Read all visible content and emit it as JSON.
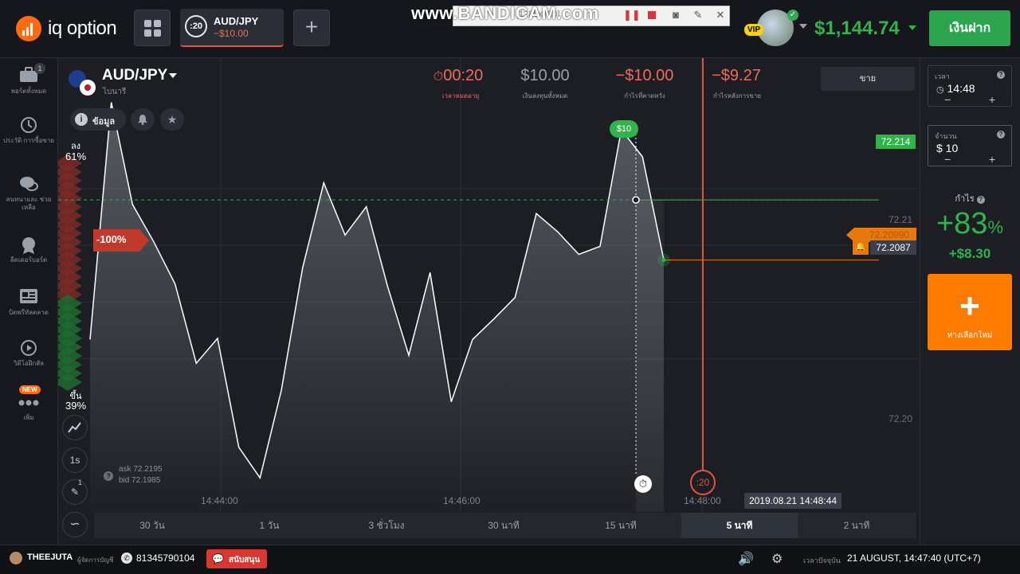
{
  "header": {
    "logo_text": "iq option",
    "asset_tab": {
      "timer": ":20",
      "name": "AUD/JPY",
      "loss": "−$10.00"
    },
    "add_tab_label": "+",
    "recorder": {
      "brand": "www.BANDICAM.com",
      "info": "[1280x720]"
    },
    "vip_label": "VIP",
    "balance": "$1,144.74",
    "deposit_label": "เงินฝาก"
  },
  "sidebar": {
    "items": [
      {
        "label": "พอร์ตทั้งหมด",
        "icon": "briefcase-icon",
        "badge": "1"
      },
      {
        "label": "ประวัติ การซื้อขาย",
        "icon": "history-icon"
      },
      {
        "label": "สนทนาและ ช่วยเหลือ",
        "icon": "chat-icon"
      },
      {
        "label": "ลีดเดอร์บอร์ด",
        "icon": "leaderboard-icon"
      },
      {
        "label": "บิดพรีทัลตลาด",
        "icon": "news-icon"
      },
      {
        "label": "วิดีโอฝึกสัล",
        "icon": "video-icon"
      },
      {
        "label": "เพิ่ม",
        "icon": "more-icon",
        "badge": "NEW"
      }
    ]
  },
  "asset": {
    "pair": "AUD/JPY",
    "type": "ไบนารี",
    "info_label": "ข้อมูล"
  },
  "stats": {
    "timer": {
      "value": "00:20",
      "label": "เวลาหมดอายุ"
    },
    "investment": {
      "value": "$10.00",
      "label": "เงินลงทุนทั้งหมด"
    },
    "expected": {
      "value": "−$10.00",
      "label": "กำไรที่คาดหวัง"
    },
    "after_sell": {
      "value": "−$9.27",
      "label": "กำไรหลังการขาย"
    },
    "sell_label": "ขาย"
  },
  "sentiment": {
    "down_label": "ลง",
    "down_pct": "61%",
    "up_label": "ขึ้น",
    "up_pct": "39%",
    "loss_tag": "-100%"
  },
  "chart": {
    "price_labels": {
      "entry": "72.214",
      "current": "72.2087",
      "level_high": "72.21",
      "level_low": "72.20",
      "overlay": "72.20990"
    },
    "trade_tag": "$10",
    "countdown_tag": ":20",
    "time_labels": [
      "14:44:00",
      "14:46:00",
      "14:48:00"
    ],
    "date_tag": "2019.08.21 14:48:44",
    "ask": "ask 72.2195",
    "bid": "bid 72.1985",
    "tool_labels": {
      "interval": "1s",
      "draw_badge": "1"
    }
  },
  "chart_data": {
    "type": "area",
    "x": [
      "14:43:10",
      "14:43:20",
      "14:43:30",
      "14:43:40",
      "14:43:50",
      "14:44:00",
      "14:44:10",
      "14:44:20",
      "14:44:30",
      "14:44:40",
      "14:44:50",
      "14:45:00",
      "14:45:10",
      "14:45:20",
      "14:45:30",
      "14:45:40",
      "14:45:50",
      "14:46:00",
      "14:46:10",
      "14:46:20",
      "14:46:30",
      "14:46:40",
      "14:46:50",
      "14:47:00",
      "14:47:10",
      "14:47:20",
      "14:47:30",
      "14:47:40"
    ],
    "y": [
      72.2017,
      72.2226,
      72.2136,
      72.2103,
      72.2066,
      72.1996,
      72.2018,
      72.1922,
      72.1895,
      72.1972,
      72.208,
      72.2155,
      72.2109,
      72.2134,
      72.2064,
      72.2003,
      72.2076,
      72.1962,
      72.2017,
      72.2035,
      72.2054,
      72.2128,
      72.2112,
      72.2092,
      72.2099,
      72.2202,
      72.2178,
      72.2087
    ],
    "ylim": [
      72.1865,
      72.2265
    ],
    "entry_price": 72.214,
    "current_price": 72.2087,
    "xlabel": "",
    "ylabel": ""
  },
  "timeframes": [
    {
      "label": "30 วัน",
      "active": false
    },
    {
      "label": "1 วัน",
      "active": false
    },
    {
      "label": "3 ชั่วโมง",
      "active": false
    },
    {
      "label": "30 นาที",
      "active": false
    },
    {
      "label": "15 นาที",
      "active": false
    },
    {
      "label": "5 นาที",
      "active": true
    },
    {
      "label": "2 นาที",
      "active": false
    }
  ],
  "right_panel": {
    "time": {
      "label": "เวลา",
      "value": "14:48",
      "minus": "−",
      "plus": "+"
    },
    "amount": {
      "label": "จำนวน",
      "value": "$ 10",
      "minus": "−",
      "plus": "+"
    },
    "profit_label": "กำไร",
    "profit_pct_main": "+83",
    "profit_pct_sign": "%",
    "profit_amount": "+$8.30",
    "new_option_label": "ทางเลือกใหม่"
  },
  "footer": {
    "username": "THEEJUTA",
    "manager_label": "ผู้จัดการบัญชี",
    "phone": "81345790104",
    "support_label": "สนับสนุน",
    "time_label": "เวลาปัจจุบัน",
    "time": "21 AUGUST, 14:47:40 (UTC+7)"
  },
  "colors": {
    "accent_green": "#30b34a",
    "accent_orange": "#ff7b00",
    "loss_red": "#ef6b5a",
    "expiry_line": "#e2533e"
  }
}
